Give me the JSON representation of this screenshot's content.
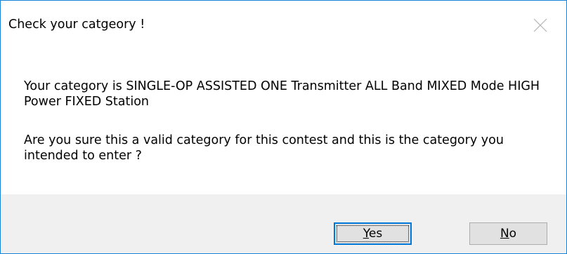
{
  "dialog": {
    "title": "Check your catgeory !",
    "message_line1": "Your category is SINGLE-OP ASSISTED ONE Transmitter ALL Band MIXED Mode HIGH Power FIXED Station",
    "message_line2": "Are you sure this a valid category for this contest and this is the category you intended to enter ?"
  },
  "buttons": {
    "yes": {
      "accel": "Y",
      "rest": "es"
    },
    "no": {
      "accel": "N",
      "rest": "o"
    }
  },
  "icons": {
    "close": "close-icon"
  },
  "colors": {
    "window_border": "#1883d7",
    "button_bar": "#f0f0f0",
    "default_button_border": "#0078d7"
  }
}
